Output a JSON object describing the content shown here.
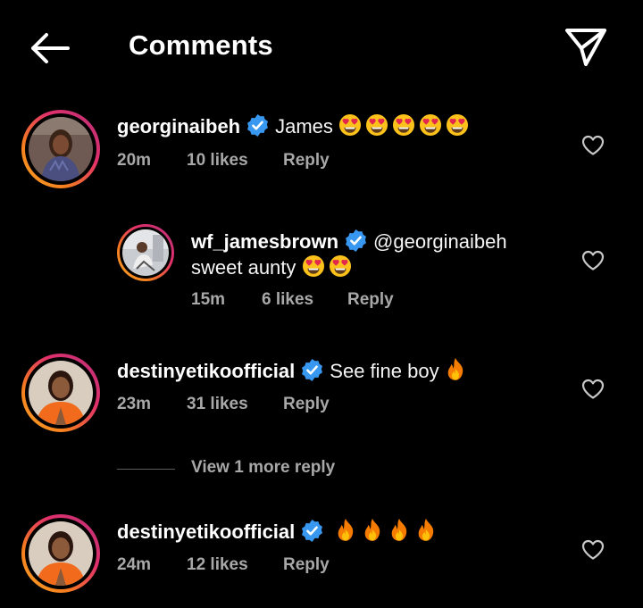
{
  "header": {
    "title": "Comments",
    "back_icon": "arrow-left-icon",
    "share_icon": "paper-plane-icon"
  },
  "colors": {
    "background": "#000000",
    "verified_badge": "#3897f0",
    "meta_text": "#a8a8a8",
    "story_ring_start": "#f9a825",
    "story_ring_end": "#b8327a"
  },
  "comments": [
    {
      "username": "georginaibeh",
      "verified": true,
      "text": "James",
      "emojis": [
        "heart-eyes-emoji",
        "heart-eyes-emoji",
        "heart-eyes-emoji",
        "heart-eyes-emoji",
        "heart-eyes-emoji"
      ],
      "time": "20m",
      "likes": "10 likes",
      "reply": "Reply"
    },
    {
      "username": "wf_jamesbrown",
      "verified": true,
      "mention": "@georginaibeh",
      "text": "sweet aunty",
      "emojis": [
        "heart-eyes-emoji",
        "heart-eyes-emoji"
      ],
      "time": "15m",
      "likes": "6 likes",
      "reply": "Reply"
    },
    {
      "username": "destinyetikoofficial",
      "verified": true,
      "text": "See fine boy",
      "emojis": [
        "fire-emoji"
      ],
      "time": "23m",
      "likes": "31 likes",
      "reply": "Reply"
    },
    {
      "username": "destinyetikoofficial",
      "verified": true,
      "text": "",
      "emojis": [
        "fire-emoji",
        "fire-emoji",
        "fire-emoji",
        "fire-emoji"
      ],
      "time": "24m",
      "likes": "12 likes",
      "reply": "Reply"
    }
  ],
  "view_more_replies": "View 1 more reply"
}
